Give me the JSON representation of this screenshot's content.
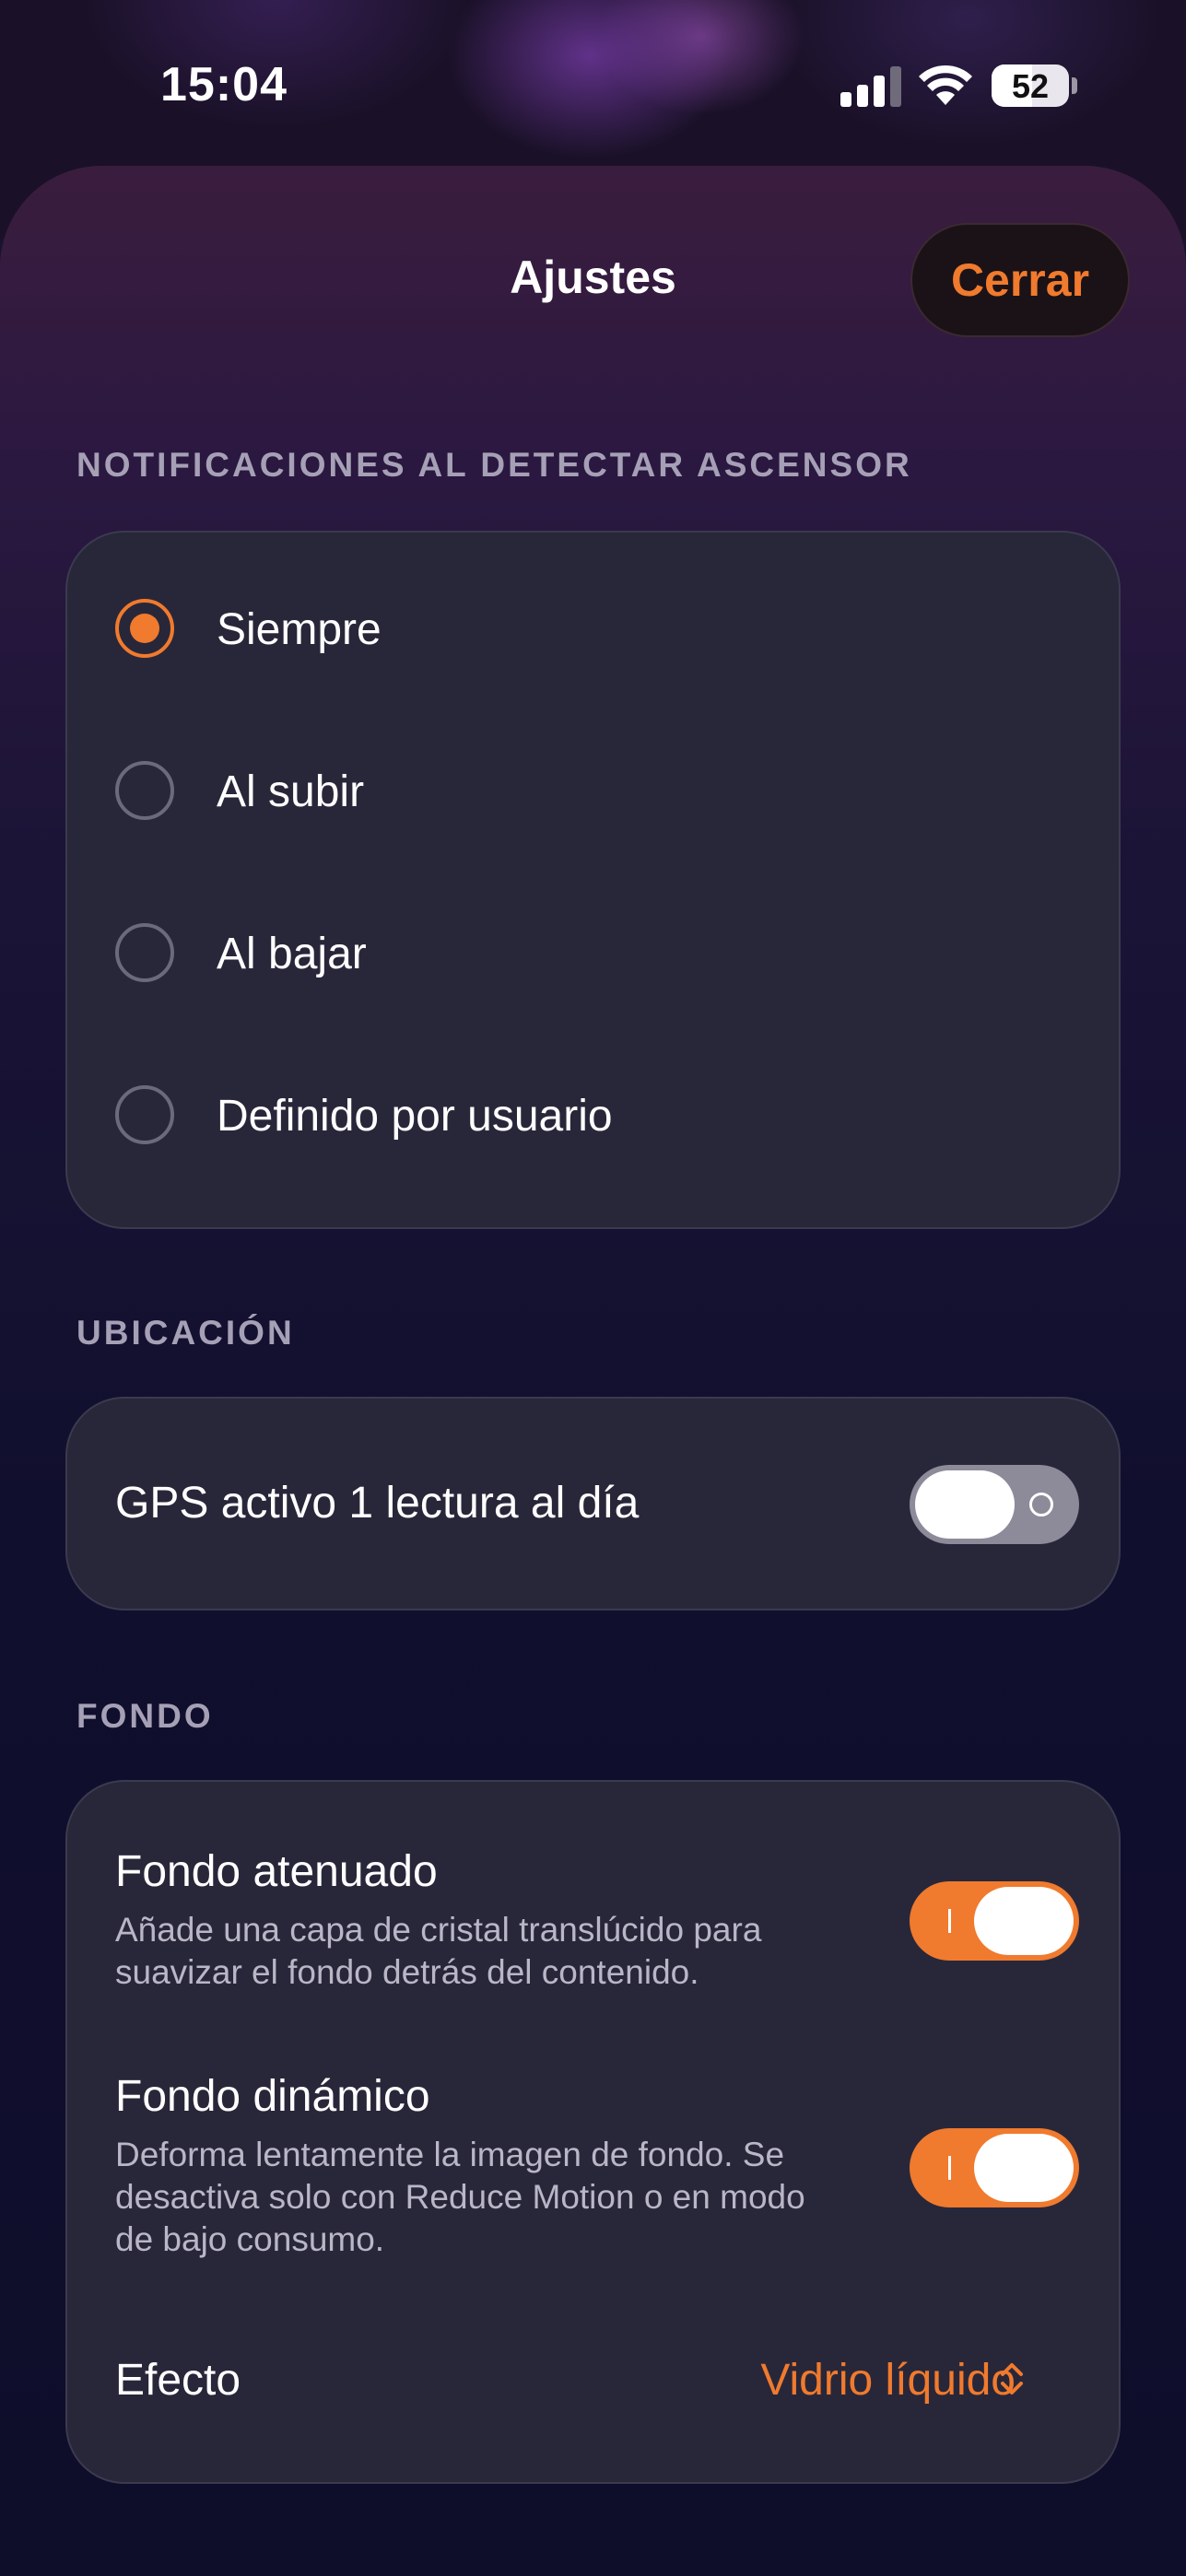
{
  "status_bar": {
    "time": "15:04",
    "battery": "52",
    "battery_level": 0.52
  },
  "sheet": {
    "title": "Ajustes",
    "close_label": "Cerrar"
  },
  "sections": {
    "notifications": {
      "header": "NOTIFICACIONES AL DETECTAR ASCENSOR",
      "options": [
        {
          "label": "Siempre",
          "selected": true
        },
        {
          "label": "Al subir",
          "selected": false
        },
        {
          "label": "Al bajar",
          "selected": false
        },
        {
          "label": "Definido por usuario",
          "selected": false
        }
      ]
    },
    "location": {
      "header": "UBICACIÓN",
      "gps_label": "GPS activo 1 lectura al día",
      "gps_enabled": false
    },
    "background": {
      "header": "FONDO",
      "dimmed_title": "Fondo atenuado",
      "dimmed_desc_1": "Añade una capa de cristal translúcido para",
      "dimmed_desc_2": "suavizar el fondo detrás del contenido.",
      "dimmed_enabled": true,
      "dynamic_title": "Fondo dinámico",
      "dynamic_desc_1": "Deforma lentamente la imagen de fondo. Se",
      "dynamic_desc_2": "desactiva solo con Reduce Motion o en modo",
      "dynamic_desc_3": "de bajo consumo.",
      "dynamic_enabled": true,
      "effect_label": "Efecto",
      "effect_value": "Vidrio líquido"
    }
  },
  "colors": {
    "accent": "#f07a2d",
    "card": "#28273a"
  }
}
